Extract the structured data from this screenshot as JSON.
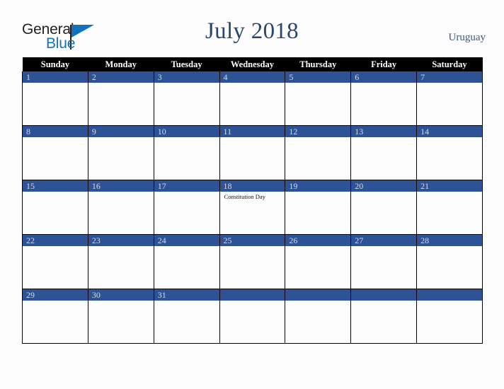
{
  "logo": {
    "word_one": "General",
    "word_two": "Blue",
    "triangle_icon": "triangle-icon"
  },
  "header": {
    "title": "July 2018",
    "country": "Uruguay"
  },
  "colors": {
    "title": "#2b4573",
    "country": "#44557d",
    "day_bar": "#2d5295",
    "weekday_header_bg": "#000000",
    "weekday_header_text": "#ffffff",
    "logo_blue": "#1273bd",
    "page_bg": "#fdfdfd"
  },
  "calendar": {
    "weekdays": [
      "Sunday",
      "Monday",
      "Tuesday",
      "Wednesday",
      "Thursday",
      "Friday",
      "Saturday"
    ],
    "weeks": [
      [
        {
          "day": "1",
          "events": []
        },
        {
          "day": "2",
          "events": []
        },
        {
          "day": "3",
          "events": []
        },
        {
          "day": "4",
          "events": []
        },
        {
          "day": "5",
          "events": []
        },
        {
          "day": "6",
          "events": []
        },
        {
          "day": "7",
          "events": []
        }
      ],
      [
        {
          "day": "8",
          "events": []
        },
        {
          "day": "9",
          "events": []
        },
        {
          "day": "10",
          "events": []
        },
        {
          "day": "11",
          "events": []
        },
        {
          "day": "12",
          "events": []
        },
        {
          "day": "13",
          "events": []
        },
        {
          "day": "14",
          "events": []
        }
      ],
      [
        {
          "day": "15",
          "events": []
        },
        {
          "day": "16",
          "events": []
        },
        {
          "day": "17",
          "events": []
        },
        {
          "day": "18",
          "events": [
            "Constitution Day"
          ]
        },
        {
          "day": "19",
          "events": []
        },
        {
          "day": "20",
          "events": []
        },
        {
          "day": "21",
          "events": []
        }
      ],
      [
        {
          "day": "22",
          "events": []
        },
        {
          "day": "23",
          "events": []
        },
        {
          "day": "24",
          "events": []
        },
        {
          "day": "25",
          "events": []
        },
        {
          "day": "26",
          "events": []
        },
        {
          "day": "27",
          "events": []
        },
        {
          "day": "28",
          "events": []
        }
      ],
      [
        {
          "day": "29",
          "events": []
        },
        {
          "day": "30",
          "events": []
        },
        {
          "day": "31",
          "events": []
        },
        {
          "day": "",
          "events": []
        },
        {
          "day": "",
          "events": []
        },
        {
          "day": "",
          "events": []
        },
        {
          "day": "",
          "events": []
        }
      ]
    ]
  }
}
